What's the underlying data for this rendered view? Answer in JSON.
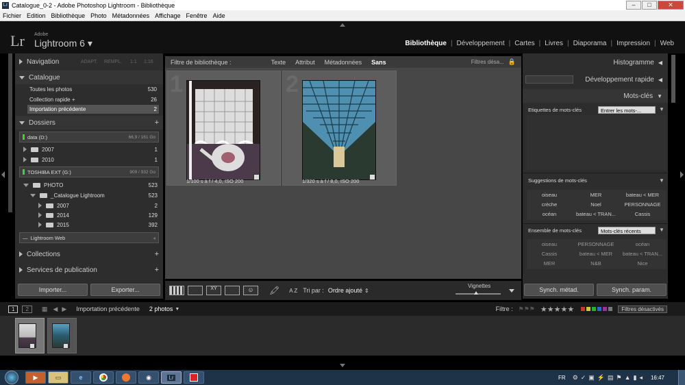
{
  "window": {
    "title": "Catalogue_0-2 - Adobe Photoshop Lightroom - Bibliothèque",
    "controls": [
      "–",
      "□",
      "✕"
    ]
  },
  "menu": [
    "Fichier",
    "Edition",
    "Bibliothèque",
    "Photo",
    "Métadonnées",
    "Affichage",
    "Fenêtre",
    "Aide"
  ],
  "brand": {
    "logo": "Lr",
    "adobe": "Adobe",
    "name": "Lightroom 6",
    "arrow": "▾"
  },
  "modules": [
    "Bibliothèque",
    "Développement",
    "Cartes",
    "Livres",
    "Diaporama",
    "Impression",
    "Web"
  ],
  "left": {
    "navigation": {
      "label": "Navigation",
      "zoom": [
        "ADAPT.",
        "REMPL.",
        "1:1",
        "1:16"
      ]
    },
    "catalogue": {
      "label": "Catalogue",
      "items": [
        {
          "label": "Toutes les photos",
          "count": "530"
        },
        {
          "label": "Collection rapide +",
          "count": "26"
        },
        {
          "label": "Importation précédente",
          "count": "2"
        }
      ]
    },
    "dossiers": {
      "label": "Dossiers",
      "plus": "+",
      "drive1": {
        "name": "data (D:)",
        "size": "66,9 / 161 Go"
      },
      "d1folders": [
        {
          "name": "2007",
          "count": "1"
        },
        {
          "name": "2010",
          "count": "1"
        }
      ],
      "drive2": {
        "name": "TOSHIBA EXT (G:)",
        "size": "909 / 932 Go"
      },
      "photo": {
        "name": "PHOTO",
        "count": "523"
      },
      "catalogue": {
        "name": "_Catalogue Lightroom",
        "count": "523"
      },
      "sub": [
        {
          "name": "2007",
          "count": "2"
        },
        {
          "name": "2014",
          "count": "129"
        },
        {
          "name": "2015",
          "count": "392"
        }
      ],
      "web": "Lightroom Web"
    },
    "collections": {
      "label": "Collections",
      "plus": "+"
    },
    "services": {
      "label": "Services de publication",
      "plus": "+"
    },
    "import": "Importer...",
    "export": "Exporter..."
  },
  "filter": {
    "label": "Filtre de bibliothèque :",
    "tabs": [
      "Texte",
      "Attribut",
      "Métadonnées",
      "Sans"
    ],
    "state": "Filtres désa..."
  },
  "grid": [
    {
      "num": "1",
      "info": "1/100 s à f / 4,0, ISO 200"
    },
    {
      "num": "2",
      "info": "1/320 s à f / 8,0, ISO 200"
    }
  ],
  "toolbar": {
    "sort_label": "Tri par :",
    "sort_value": "Ordre ajouté",
    "sort_arrow": "⇕",
    "az": "A Z",
    "vignettes": "Vignettes"
  },
  "right": {
    "histogramme": "Histogramme",
    "devrapide": "Développement rapide",
    "motscles": "Mots-clés",
    "etiquettes": {
      "label": "Etiquettes de mots-clés",
      "select": "Entrer les mots-..."
    },
    "suggestions": {
      "label": "Suggestions de mots-clés",
      "words": [
        "oiseau",
        "MER",
        "bateau < MER",
        "crèche",
        "Noel",
        "PERSONNAGE",
        "océan",
        "bateau < TRAN...",
        "Cassis"
      ]
    },
    "ensemble": {
      "label": "Ensemble de mots-clés",
      "select": "Mots-clés récents",
      "words": [
        "oiseau",
        "PERSONNAGE",
        "océan",
        "Cassis",
        "bateau < MER",
        "bateau < TRAN...",
        "MER",
        "N&B",
        "Nice"
      ]
    },
    "synch_metad": "Synch. métad.",
    "synch_param": "Synch. param."
  },
  "filmbar": {
    "p1": "1",
    "p2": "2",
    "source": "Importation précédente",
    "count": "2 photos",
    "filtre": "Filtre :",
    "stars": "★★★★★",
    "filters_off": "Filtres désactivés"
  },
  "taskbar": {
    "lang": "FR",
    "time": "16:47",
    "lr": "Lr"
  }
}
